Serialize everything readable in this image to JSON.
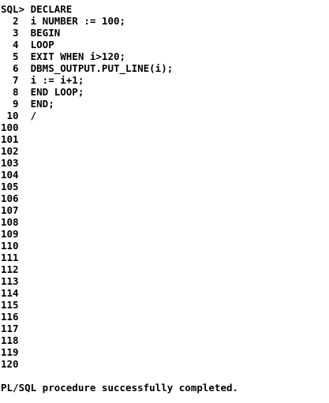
{
  "console": {
    "session_lines": [
      "SQL> DECLARE",
      "  2  i NUMBER := 100;",
      "  3  BEGIN",
      "  4  LOOP",
      "  5  EXIT WHEN i>120;",
      "  6  DBMS_OUTPUT.PUT_LINE(i);",
      "  7  i := i+1;",
      "  8  END LOOP;",
      "  9  END;",
      " 10  /",
      "100",
      "101",
      "102",
      "103",
      "104",
      "105",
      "106",
      "107",
      "108",
      "109",
      "110",
      "111",
      "112",
      "113",
      "114",
      "115",
      "116",
      "117",
      "118",
      "119",
      "120"
    ],
    "status_message": "PL/SQL procedure successfully completed."
  }
}
